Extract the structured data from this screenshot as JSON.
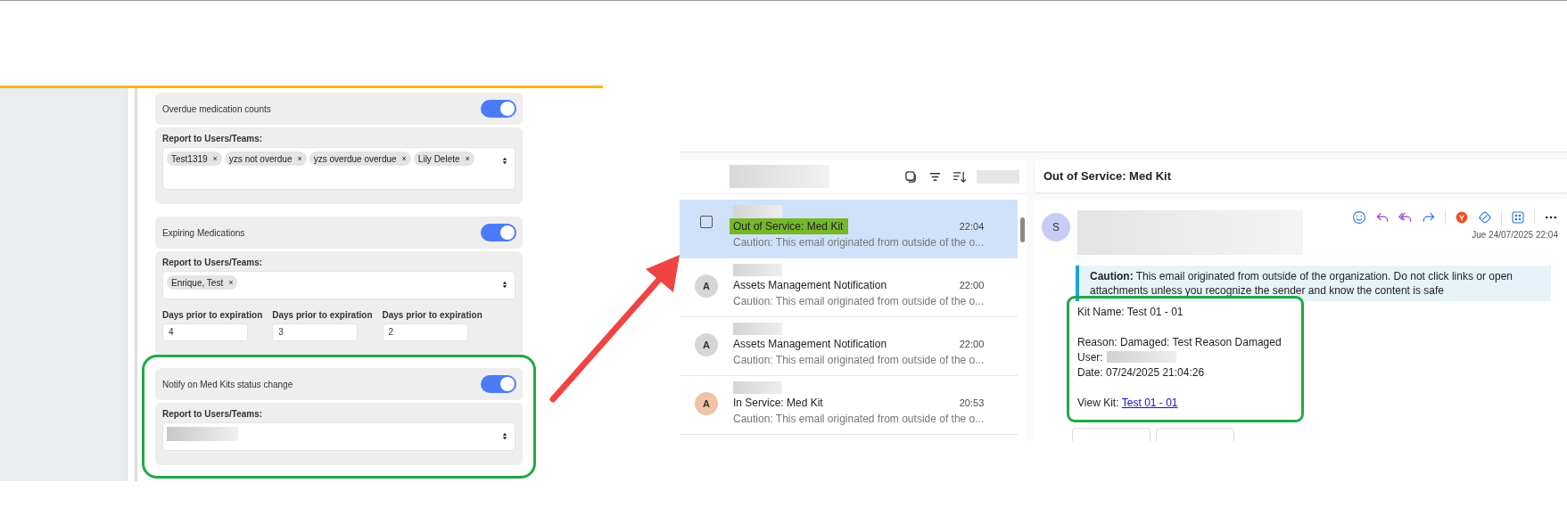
{
  "settings": {
    "sections": [
      {
        "kind": "tags",
        "title": "Overdue medication counts",
        "on": true,
        "highlighted": false,
        "report_label": "Report to Users/Teams:",
        "tags": [
          {
            "label": "Test1319",
            "remove": "×"
          },
          {
            "label": "yzs not overdue",
            "remove": "×"
          },
          {
            "label": "yzs overdue overdue",
            "remove": "×"
          },
          {
            "label": "Lily Delete",
            "remove": "×"
          }
        ]
      },
      {
        "kind": "expiry",
        "title": "Expiring Medications",
        "on": true,
        "highlighted": false,
        "report_label": "Report to Users/Teams:",
        "tags": [
          {
            "label": "Enrique, Test",
            "remove": "×"
          }
        ],
        "days_fields": [
          {
            "label": "Days prior to expiration",
            "value": "4"
          },
          {
            "label": "Days prior to expiration",
            "value": "3"
          },
          {
            "label": "Days prior to expiration",
            "value": "2"
          }
        ]
      },
      {
        "kind": "redacted",
        "title": "Notify on Med Kits status change",
        "on": true,
        "highlighted": true,
        "report_label": "Report to Users/Teams:"
      }
    ]
  },
  "mail": {
    "list": {
      "messages": [
        {
          "kind": "checkbox",
          "checked": false,
          "selected": true,
          "highlighted": true,
          "subject": "Out of Service: Med Kit",
          "time": "22:04",
          "preview": "Caution: This email originated from outside of the o..."
        },
        {
          "kind": "avatar",
          "initial": "A",
          "color": "#d6d6d6",
          "selected": false,
          "highlighted": false,
          "subject": "Assets Management Notification",
          "time": "22:00",
          "preview": "Caution: This email originated from outside of the o..."
        },
        {
          "kind": "avatar",
          "initial": "A",
          "color": "#d6d6d6",
          "selected": false,
          "highlighted": false,
          "subject": "Assets Management Notification",
          "time": "22:00",
          "preview": "Caution: This email originated from outside of the o..."
        },
        {
          "kind": "avatar",
          "initial": "A",
          "color": "#f2c2a8",
          "selected": false,
          "highlighted": false,
          "subject": "In Service: Med Kit",
          "time": "20:53",
          "preview": "Caution: This email originated from outside of the o..."
        }
      ]
    },
    "reading": {
      "subject": "Out of Service: Med Kit",
      "sender_initial": "S",
      "date": "Jue 24/07/2025 22:04",
      "caution": "**Caution:** This email originated from outside of the organization. Do not click links or open attachments unless you recognize the sender and know the content is safe",
      "body_highlighted": true,
      "body": [
        {
          "kind": "text",
          "text": "Kit Name: Test 01 - 01"
        },
        {
          "kind": "blank"
        },
        {
          "kind": "text",
          "text": "Reason: Damaged: Test Reason Damaged"
        },
        {
          "kind": "redacted",
          "text": "User:"
        },
        {
          "kind": "text",
          "text": "Date: 07/24/2025 21:04:26"
        },
        {
          "kind": "blank"
        },
        {
          "kind": "link",
          "text": "View Kit:",
          "link": "Test 01 - 01"
        }
      ]
    }
  }
}
